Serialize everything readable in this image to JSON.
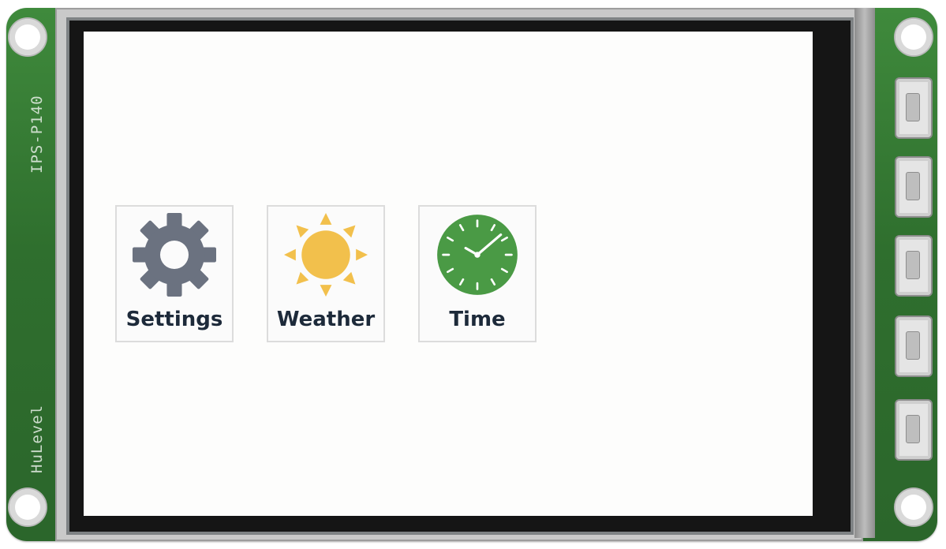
{
  "board": {
    "silk_top": "IPS-P140",
    "silk_bottom": "HuLevel"
  },
  "apps": [
    {
      "label": "Settings",
      "icon": "gear-icon"
    },
    {
      "label": "Weather",
      "icon": "sun-icon"
    },
    {
      "label": "Time",
      "icon": "clock-icon"
    }
  ],
  "colors": {
    "pcb": "#2f6f2e",
    "screen": "#fdfdfc",
    "gear": "#6b7280",
    "sun": "#f2c04c",
    "clock": "#4a9a45",
    "label": "#1d2a3a"
  }
}
